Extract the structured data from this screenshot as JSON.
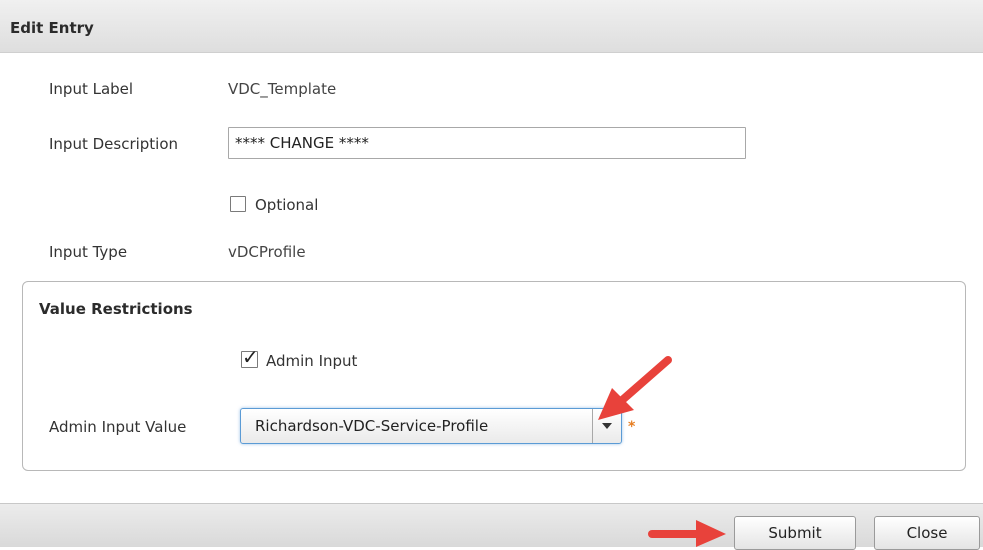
{
  "dialog": {
    "title": "Edit Entry"
  },
  "form": {
    "input_label": {
      "label": "Input Label",
      "value": "VDC_Template"
    },
    "input_description": {
      "label": "Input Description",
      "value": "**** CHANGE ****"
    },
    "optional": {
      "label": "Optional",
      "checked": false
    },
    "input_type": {
      "label": "Input Type",
      "value": "vDCProfile"
    }
  },
  "value_restrictions": {
    "title": "Value Restrictions",
    "admin_input": {
      "label": "Admin Input",
      "checked": true
    },
    "admin_input_value": {
      "label": "Admin Input Value",
      "selected": "Richardson-VDC-Service-Profile",
      "required_mark": "*"
    }
  },
  "footer": {
    "submit_label": "Submit",
    "close_label": "Close"
  },
  "colors": {
    "annotation_arrow": "#e8423b",
    "focus_border": "#5b9bd5",
    "required": "#e67e22"
  },
  "icons": [
    "checkbox-unchecked-icon",
    "checkbox-checked-icon",
    "chevron-down-icon",
    "annotation-arrow-icon"
  ]
}
